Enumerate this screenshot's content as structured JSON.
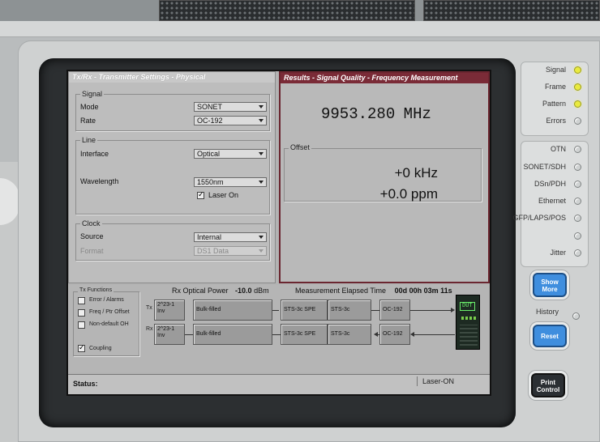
{
  "tx_panel": {
    "title": "Tx/Rx - Transmitter Settings - Physical",
    "signal": {
      "group": "Signal",
      "mode_label": "Mode",
      "mode_value": "SONET",
      "rate_label": "Rate",
      "rate_value": "OC-192"
    },
    "line": {
      "group": "Line",
      "interface_label": "Interface",
      "interface_value": "Optical",
      "wavelength_label": "Wavelength",
      "wavelength_value": "1550nm",
      "laser_on_label": "Laser On",
      "laser_on": true
    },
    "clock": {
      "group": "Clock",
      "source_label": "Source",
      "source_value": "Internal",
      "format_label": "Format",
      "format_value": "DS1 Data"
    }
  },
  "results": {
    "title": "Results - Signal Quality - Frequency Measurement",
    "frequency": "9953.280",
    "frequency_unit": "MHz",
    "offset_group": "Offset",
    "offset_khz": "+0 kHz",
    "offset_ppm": "+0.0 ppm"
  },
  "tx_functions": {
    "title": "Tx Functions",
    "items": [
      {
        "label": "Error / Alarms",
        "checked": false
      },
      {
        "label": "Freq / Ptr Offset",
        "checked": false
      },
      {
        "label": "Non-default OH",
        "checked": false
      }
    ],
    "coupling_label": "Coupling",
    "coupling": true
  },
  "rx_optical": {
    "label": "Rx Optical Power",
    "value": "-10.0",
    "unit": "dBm"
  },
  "elapsed": {
    "label": "Measurement Elapsed Time",
    "value": "00d 00h 03m 11s"
  },
  "signal_path": {
    "tx_label": "Tx",
    "rx_label": "Rx",
    "tx_blocks": [
      "2^23-1 Inv",
      "Bulk-filled",
      "STS-3c SPE",
      "STS-3c",
      "OC-192"
    ],
    "rx_blocks": [
      "2^23-1 Inv",
      "Bulk-filled",
      "STS-3c SPE",
      "STS-3c",
      "OC-192"
    ],
    "dut": "DUT"
  },
  "status": {
    "label": "Status:",
    "laser": "Laser-ON"
  },
  "leds": [
    {
      "label": "Signal",
      "on": true
    },
    {
      "label": "Frame",
      "on": true
    },
    {
      "label": "Pattern",
      "on": true
    },
    {
      "label": "Errors",
      "on": false
    },
    {
      "label": "OTN",
      "on": false
    },
    {
      "label": "SONET/SDH",
      "on": false
    },
    {
      "label": "DSn/PDH",
      "on": false
    },
    {
      "label": "Ethernet",
      "on": false
    },
    {
      "label": "GFP/LAPS/POS",
      "on": false
    },
    {
      "label": "",
      "on": false
    },
    {
      "label": "Jitter",
      "on": false
    }
  ],
  "buttons": {
    "show_more": "Show More",
    "history": "History",
    "reset": "Reset",
    "print_control": "Print Control"
  },
  "colors": {
    "results_header": "#7a2b37",
    "led_on": "#e9ea3f",
    "button_blue": "#3f8ede"
  }
}
